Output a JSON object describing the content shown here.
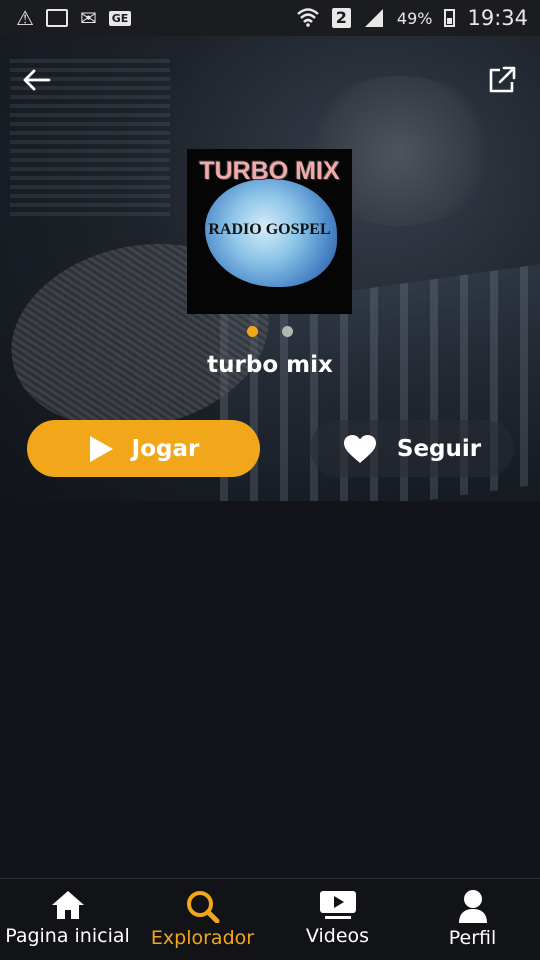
{
  "status_bar": {
    "battery": "49%",
    "time": "19:34",
    "ge": "GE",
    "sim": "2"
  },
  "hero": {
    "station_name": "turbo mix",
    "cover": {
      "title_line1": "TURBO MIX",
      "title_line2": "RADIO GOSPEL"
    },
    "carousel": {
      "count": 2,
      "active_index": 0
    },
    "play_label": "Jogar",
    "follow_label": "Seguir"
  },
  "bottom_nav": {
    "items": [
      {
        "label": "Pagina inicial",
        "icon": "home-icon"
      },
      {
        "label": "Explorador",
        "icon": "search-icon",
        "active": true
      },
      {
        "label": "Videos",
        "icon": "video-icon"
      },
      {
        "label": "Perfil",
        "icon": "profile-icon"
      }
    ]
  },
  "colors": {
    "accent": "#f2a71b",
    "background": "#13141a"
  }
}
